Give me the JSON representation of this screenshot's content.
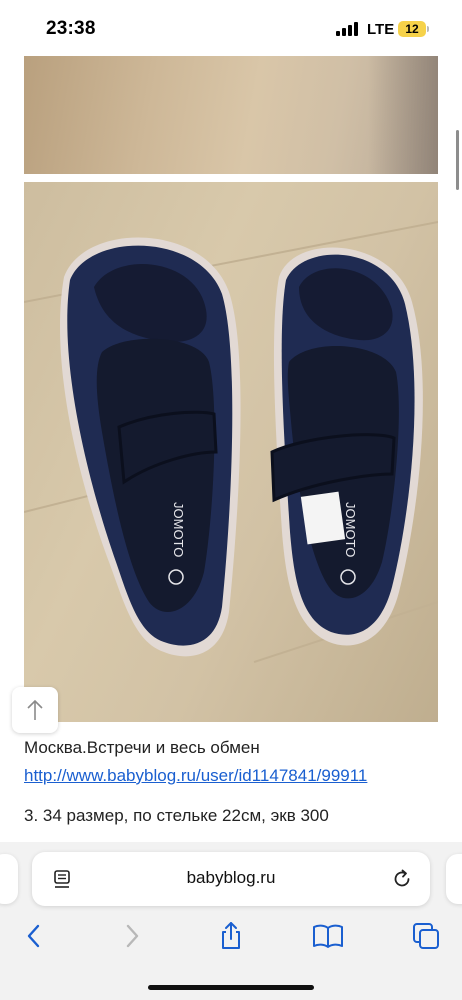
{
  "status_bar": {
    "time": "23:38",
    "network": "LTE",
    "battery": "12",
    "battery_color": "#f6d24a"
  },
  "post": {
    "caption": "Москва.Встречи и весь обмен",
    "link": "http://www.babyblog.ru/user/id1147841/99911",
    "description": "3. 34 размер, по стельке 22см, экв 300",
    "shoe_brand_mark": "JOMOTO"
  },
  "browser": {
    "address": "babyblog.ru",
    "link_color": "#1a5fd0",
    "icons": {
      "reader": "reader-icon",
      "reload": "reload-icon",
      "back": "back-icon",
      "forward": "forward-icon",
      "share": "share-icon",
      "bookmarks": "bookmarks-icon",
      "tabs": "tabs-icon",
      "back_to_top": "arrow-up-icon"
    }
  }
}
